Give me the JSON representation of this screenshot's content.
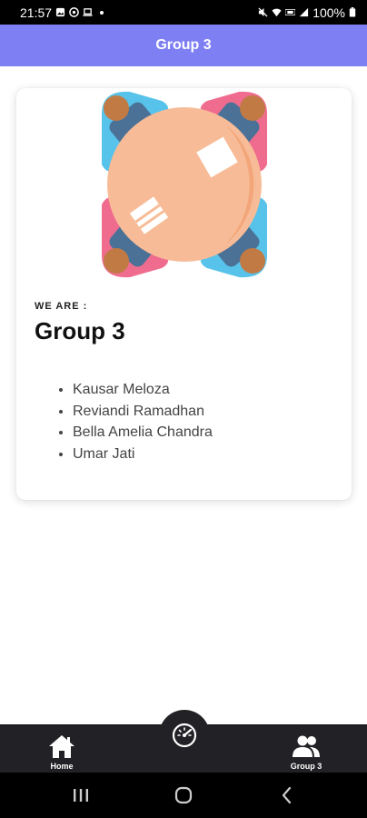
{
  "status_bar": {
    "time": "21:57",
    "battery": "100%",
    "left_icons": [
      "gallery-icon",
      "whatsapp-icon",
      "laptop-icon",
      "dot-icon"
    ],
    "right_icons": [
      "mute-icon",
      "wifi-icon",
      "volte-icon",
      "signal-icon",
      "battery-icon"
    ]
  },
  "app_bar": {
    "title": "Group 3"
  },
  "card": {
    "eyebrow": "WE ARE :",
    "title": "Group 3",
    "members": [
      "Kausar Meloza",
      "Reviandi Ramadhan",
      "Bella Amelia Chandra",
      "Umar Jati"
    ]
  },
  "bottom_nav": {
    "items": [
      {
        "label": "Home",
        "icon": "home-icon"
      },
      {
        "label": "Group 3",
        "icon": "group-icon"
      }
    ],
    "center_icon": "speedometer-icon"
  },
  "system_nav": {
    "icons": [
      "recent-apps-icon",
      "home-circle-icon",
      "back-icon"
    ]
  },
  "colors": {
    "app_bar": "#7f7ff4",
    "nav_bar": "#222226",
    "table": "#f7bc97",
    "sleeve_blue": "#58c3ea",
    "sleeve_pink": "#ef6c8f"
  }
}
